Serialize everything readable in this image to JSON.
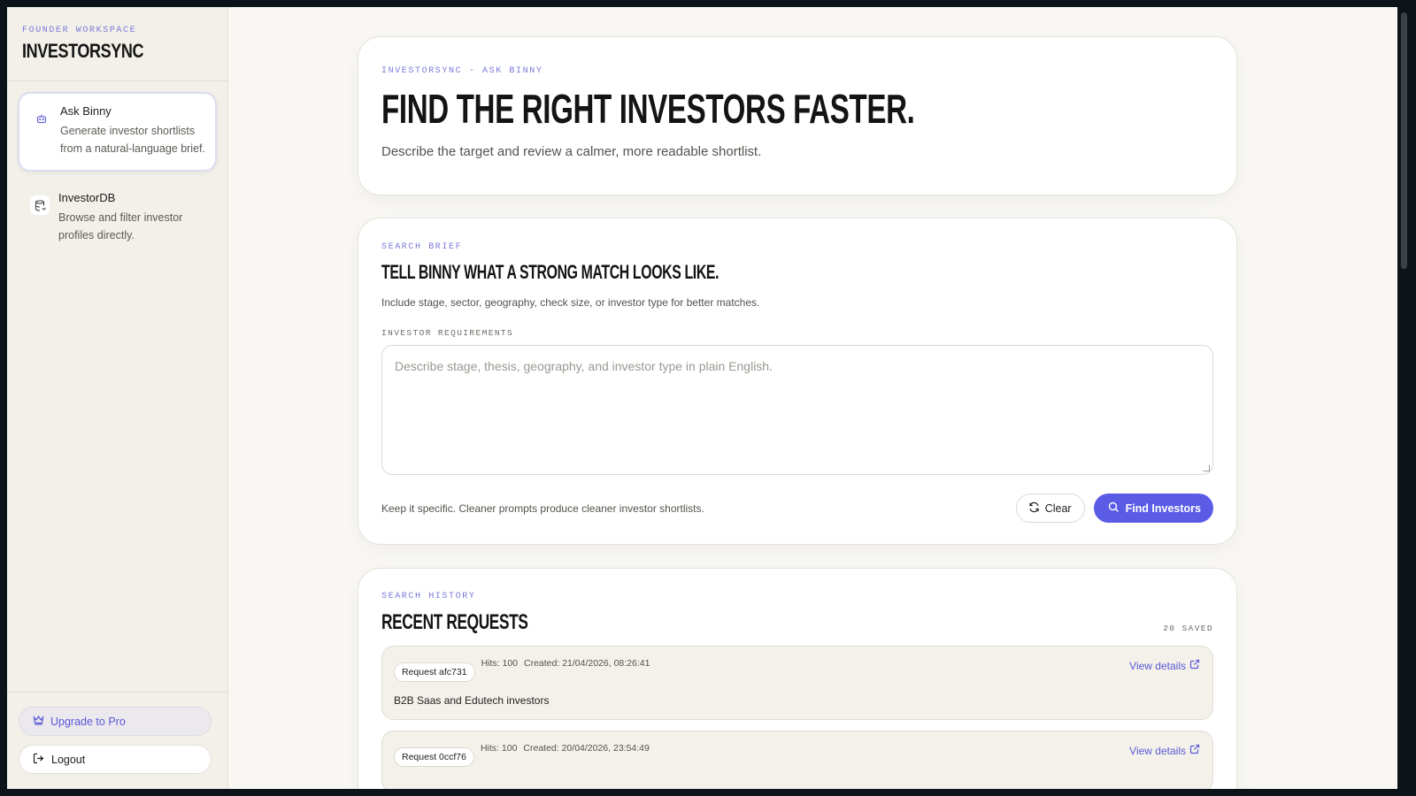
{
  "sidebar": {
    "eyebrow": "FOUNDER WORKSPACE",
    "brand": "INVESTORSYNC",
    "items": [
      {
        "title": "Ask Binny",
        "desc": "Generate investor shortlists from a natural-language brief.",
        "icon": "bot-icon",
        "active": true
      },
      {
        "title": "InvestorDB",
        "desc": "Browse and filter investor profiles directly.",
        "icon": "database-icon",
        "active": false
      }
    ],
    "upgrade_label": "Upgrade to Pro",
    "logout_label": "Logout"
  },
  "hero": {
    "eyebrow": "INVESTORSYNC - ASK BINNY",
    "title": "FIND THE RIGHT INVESTORS FASTER.",
    "subtitle": "Describe the target and review a calmer, more readable shortlist."
  },
  "brief": {
    "eyebrow": "SEARCH BRIEF",
    "title": "TELL BINNY WHAT A STRONG MATCH LOOKS LIKE.",
    "subtitle": "Include stage, sector, geography, check size, or investor type for better matches.",
    "field_label": "INVESTOR REQUIREMENTS",
    "placeholder": "Describe stage, thesis, geography, and investor type in plain English.",
    "value": "",
    "hint": "Keep it specific. Cleaner prompts produce cleaner investor shortlists.",
    "clear_label": "Clear",
    "find_label": "Find Investors"
  },
  "history": {
    "eyebrow": "SEARCH HISTORY",
    "title": "RECENT REQUESTS",
    "saved": "20 SAVED",
    "view_label": "View details",
    "requests": [
      {
        "id": "Request afc731",
        "hits": "Hits: 100",
        "created": "Created: 21/04/2026, 08:26:41",
        "text": "B2B Saas and Edutech investors"
      },
      {
        "id": "Request 0ccf76",
        "hits": "Hits: 100",
        "created": "Created: 20/04/2026, 23:54:49",
        "text": ""
      }
    ]
  },
  "colors": {
    "accent": "#5b5ce6",
    "background": "#f8f7f3",
    "sidebar": "#f2f0e9"
  }
}
